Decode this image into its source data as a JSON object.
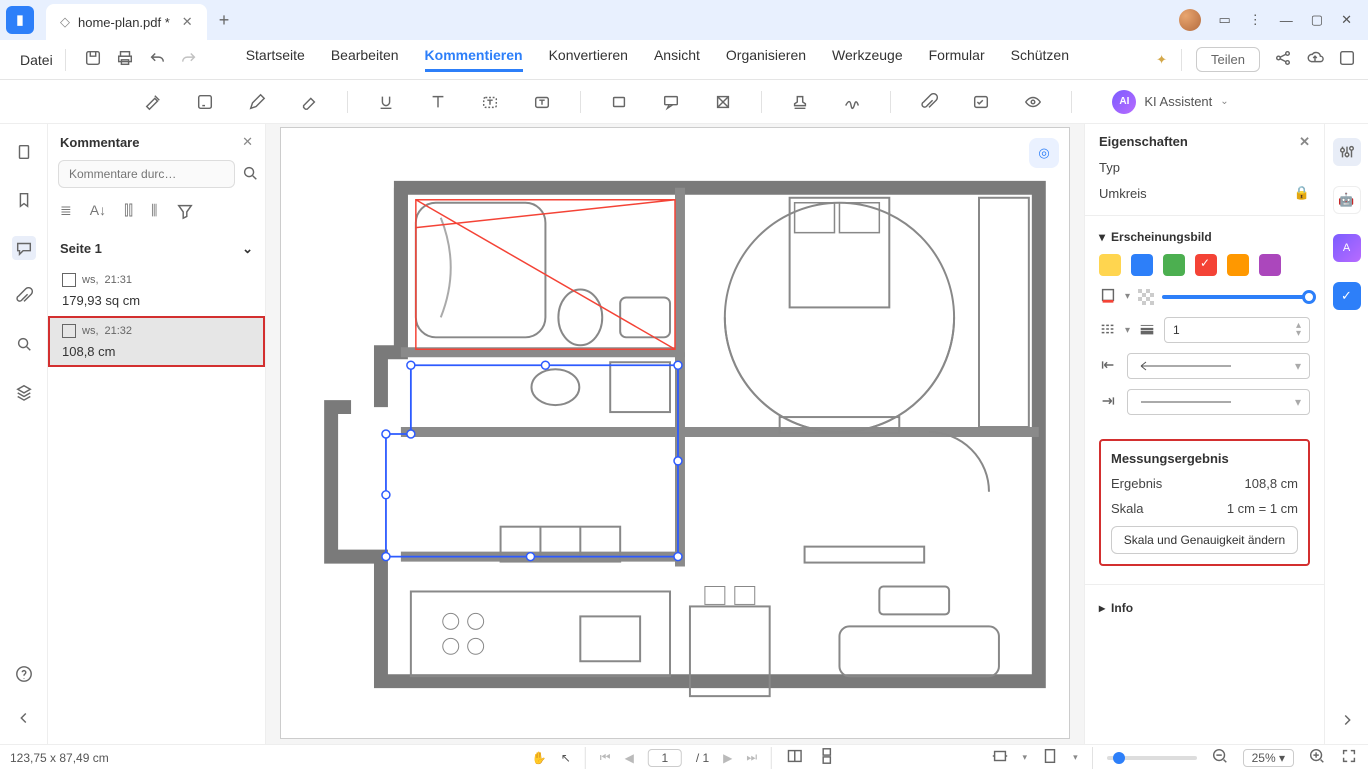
{
  "titlebar": {
    "tab_name": "home-plan.pdf *"
  },
  "menu": {
    "file": "Datei",
    "tabs": [
      "Startseite",
      "Bearbeiten",
      "Kommentieren",
      "Konvertieren",
      "Ansicht",
      "Organisieren",
      "Werkzeuge",
      "Formular",
      "Schützen"
    ],
    "active_tab_index": 2,
    "share": "Teilen"
  },
  "ai": {
    "label": "KI Assistent"
  },
  "comments": {
    "title": "Kommentare",
    "search_placeholder": "Kommentare durc…",
    "page_label": "Seite 1",
    "items": [
      {
        "author": "ws,",
        "time": "21:31",
        "value": "179,93 sq cm",
        "selected": false
      },
      {
        "author": "ws,",
        "time": "21:32",
        "value": "108,8 cm",
        "selected": true
      }
    ]
  },
  "properties": {
    "title": "Eigenschaften",
    "type_label": "Typ",
    "type_value": "Umkreis",
    "appearance_label": "Erscheinungsbild",
    "thickness_value": "1",
    "measurement": {
      "heading": "Messungsergebnis",
      "result_label": "Ergebnis",
      "result_value": "108,8 cm",
      "scale_label": "Skala",
      "scale_value": "1 cm = 1 cm",
      "button": "Skala und Genauigkeit ändern"
    },
    "info_label": "Info"
  },
  "status": {
    "coords": "123,75 x 87,49 cm",
    "page_current": "1",
    "page_total": "/ 1",
    "zoom": "25%"
  }
}
